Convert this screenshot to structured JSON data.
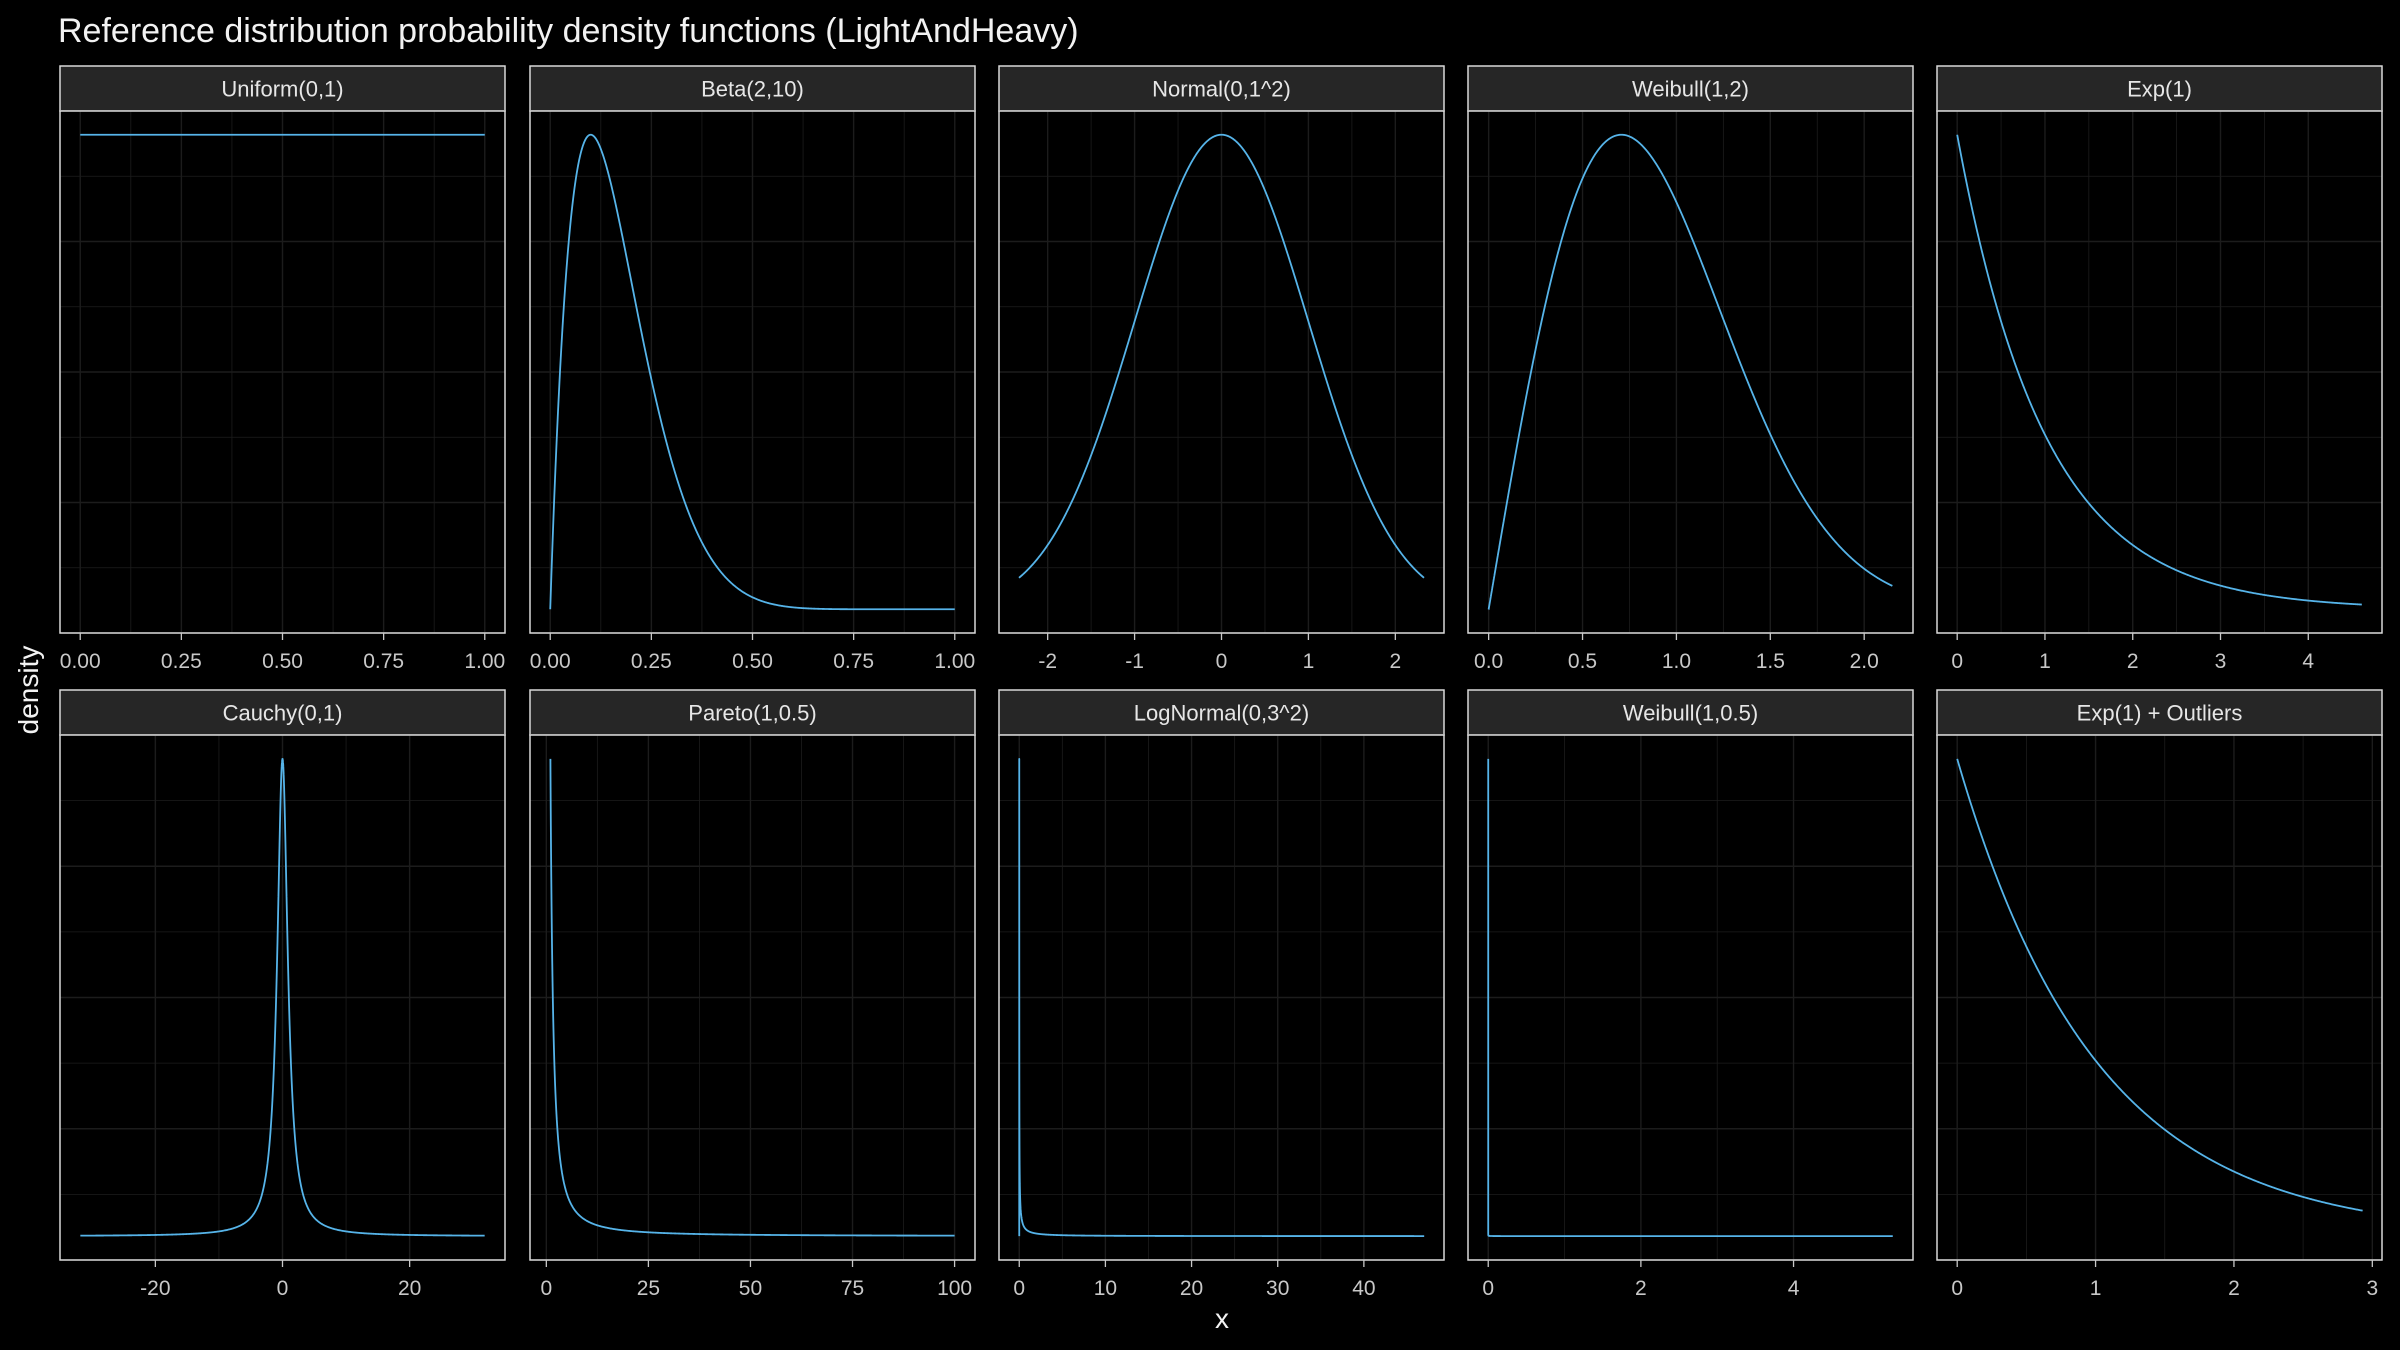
{
  "title": "Reference distribution probability density functions (LightAndHeavy)",
  "xlabel": "x",
  "ylabel": "density",
  "colors": {
    "background": "#000000",
    "panel": "#000000",
    "strip": "#262626",
    "grid": "#1c1c1c",
    "border": "#d9d9d9",
    "line": "#56b4e9"
  },
  "chart_data": [
    {
      "type": "line",
      "strip": "Uniform(0,1)",
      "dist": "uniform",
      "params": [
        0,
        1
      ],
      "xlim": [
        -0.05,
        1.05
      ],
      "x_range": [
        0,
        1
      ],
      "ticks": [
        0,
        0.25,
        0.5,
        0.75,
        1
      ],
      "tick_labels": [
        "0.00",
        "0.25",
        "0.50",
        "0.75",
        "1.00"
      ],
      "yrel": [
        -0.05,
        1.05
      ]
    },
    {
      "type": "line",
      "strip": "Beta(2,10)",
      "dist": "beta",
      "params": [
        2,
        10
      ],
      "xlim": [
        -0.05,
        1.05
      ],
      "x_range": [
        0,
        1
      ],
      "ticks": [
        0,
        0.25,
        0.5,
        0.75,
        1
      ],
      "tick_labels": [
        "0.00",
        "0.25",
        "0.50",
        "0.75",
        "1.00"
      ],
      "yrel": [
        -0.05,
        1.05
      ]
    },
    {
      "type": "line",
      "strip": "Normal(0,1^2)",
      "dist": "normal",
      "params": [
        0,
        1
      ],
      "xlim": [
        -2.56,
        2.56
      ],
      "x_range": [
        -2.33,
        2.33
      ],
      "ticks": [
        -2,
        -1,
        0,
        1,
        2
      ],
      "tick_labels": [
        "-2",
        "-1",
        "0",
        "1",
        "2"
      ],
      "yrel": [
        -0.05,
        1.05
      ]
    },
    {
      "type": "line",
      "strip": "Weibull(1,2)",
      "dist": "weibull",
      "params": [
        1,
        2
      ],
      "xlim": [
        -0.11,
        2.26
      ],
      "x_range": [
        0,
        2.15
      ],
      "ticks": [
        0,
        0.5,
        1,
        1.5,
        2
      ],
      "tick_labels": [
        "0.0",
        "0.5",
        "1.0",
        "1.5",
        "2.0"
      ],
      "yrel": [
        -0.05,
        1.05
      ]
    },
    {
      "type": "line",
      "strip": "Exp(1)",
      "dist": "exp",
      "params": [
        1
      ],
      "xlim": [
        -0.23,
        4.84
      ],
      "x_range": [
        0,
        4.61
      ],
      "ticks": [
        0,
        1,
        2,
        3,
        4
      ],
      "tick_labels": [
        "0",
        "1",
        "2",
        "3",
        "4"
      ],
      "yrel": [
        -0.05,
        1.05
      ]
    },
    {
      "type": "line",
      "strip": "Cauchy(0,1)",
      "dist": "cauchy",
      "params": [
        0,
        1
      ],
      "xlim": [
        -35,
        35
      ],
      "x_range": [
        -31.8,
        31.8
      ],
      "ticks": [
        -20,
        0,
        20
      ],
      "tick_labels": [
        "-20",
        "0",
        "20"
      ],
      "yrel": [
        -0.05,
        1.05
      ]
    },
    {
      "type": "line",
      "strip": "Pareto(1,0.5)",
      "dist": "pareto",
      "params": [
        1,
        0.5
      ],
      "xlim": [
        -4,
        105
      ],
      "x_range": [
        1,
        100
      ],
      "ticks": [
        0,
        25,
        50,
        75,
        100
      ],
      "tick_labels": [
        "0",
        "25",
        "50",
        "75",
        "100"
      ],
      "yrel": [
        -0.05,
        1.05
      ]
    },
    {
      "type": "line",
      "strip": "LogNormal(0,3^2)",
      "dist": "lognormal",
      "params": [
        0,
        3
      ],
      "xlim": [
        -2.35,
        49.3
      ],
      "x_range": [
        0,
        47
      ],
      "ticks": [
        0,
        10,
        20,
        30,
        40
      ],
      "tick_labels": [
        "0",
        "10",
        "20",
        "30",
        "40"
      ],
      "yrel": [
        -0.05,
        1.05
      ]
    },
    {
      "type": "line",
      "strip": "Weibull(1,0.5)",
      "dist": "weibull",
      "params": [
        1,
        0.5
      ],
      "xlim": [
        -0.265,
        5.565
      ],
      "x_range": [
        0,
        5.3
      ],
      "ticks": [
        0,
        2,
        4
      ],
      "tick_labels": [
        "0",
        "2",
        "4"
      ],
      "yrel": [
        -0.05,
        1.05
      ]
    },
    {
      "type": "line",
      "strip": "Exp(1) + Outliers",
      "dist": "exp",
      "params": [
        1
      ],
      "xlim": [
        -0.146,
        3.07
      ],
      "x_range": [
        0,
        2.93
      ],
      "ticks": [
        0,
        1,
        2,
        3
      ],
      "tick_labels": [
        "0",
        "1",
        "2",
        "3"
      ],
      "yrel": [
        -0.05,
        1.05
      ]
    }
  ]
}
